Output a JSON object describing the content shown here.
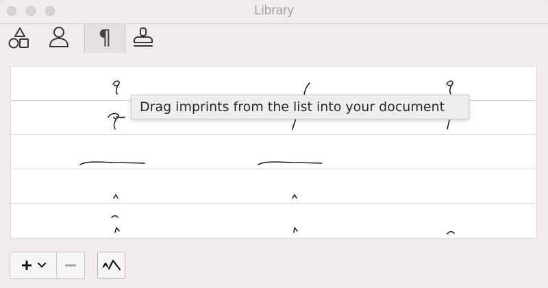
{
  "window": {
    "title": "Library"
  },
  "toolbar": {
    "tabs": [
      {
        "name": "shapes",
        "icon": "shapes-icon",
        "selected": false
      },
      {
        "name": "person",
        "icon": "person-icon",
        "selected": false
      },
      {
        "name": "text",
        "icon": "pilcrow-icon",
        "glyph": "¶",
        "selected": true
      },
      {
        "name": "stamp",
        "icon": "stamp-icon",
        "selected": false
      }
    ]
  },
  "tooltip": {
    "text": "Drag imprints from the list into your document"
  },
  "bottom": {
    "add_icon": "plus-icon",
    "add_menu_icon": "chevron-down-icon",
    "remove_icon": "minus-icon",
    "imprint_icon": "imprint-icon"
  },
  "colors": {
    "window_bg": "#f0ebec",
    "list_bg": "#ffffff",
    "tooltip_bg": "#f0eded"
  }
}
